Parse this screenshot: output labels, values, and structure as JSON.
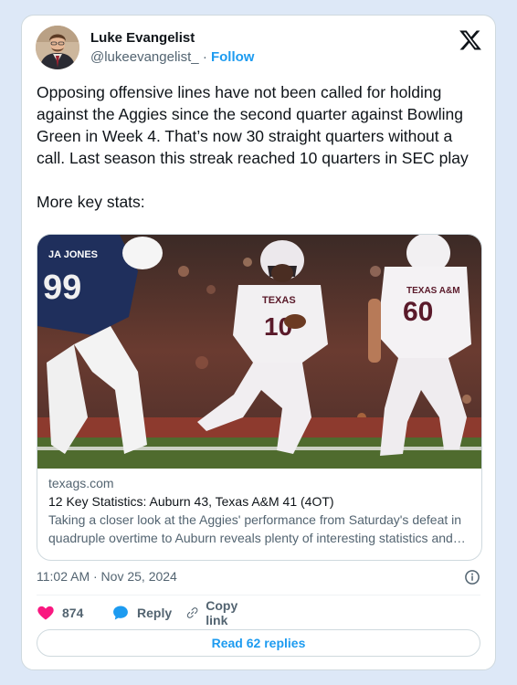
{
  "author": {
    "name": "Luke Evangelist",
    "handle": "@lukeevangelist_",
    "separator": "·",
    "follow_label": "Follow"
  },
  "tweet": {
    "text": "Opposing offensive lines have not been called for holding against the Aggies since the second quarter against Bowling Green in Week 4. That’s now 30 straight quarters without a call. Last season this streak reached 10 quarters in SEC play\n\nMore key stats:",
    "timestamp": "11:02 AM · Nov 25, 2024"
  },
  "link_card": {
    "domain": "texags.com",
    "title": "12 Key Statistics: Auburn 43, Texas A&M 41 (4OT)",
    "description": "Taking a closer look at the Aggies' performance from Saturday's defeat in quadruple overtime to Auburn reveals plenty of interesting statistics and…",
    "photo_jersey_texts": [
      "JA JONES",
      "99",
      "TEXAS",
      "10",
      "TEXAS A&M",
      "60"
    ]
  },
  "actions": {
    "like_count": "874",
    "reply_label": "Reply",
    "copy_label": "Copy link",
    "read_replies_label": "Read 62 replies"
  },
  "colors": {
    "accent": "#1d9bf0",
    "like": "#f91880",
    "text": "#0f1419",
    "muted": "#536471",
    "background": "#dde8f7"
  },
  "icons": [
    "x-logo-icon",
    "info-icon",
    "heart-icon",
    "reply-bubble-icon",
    "link-icon"
  ]
}
